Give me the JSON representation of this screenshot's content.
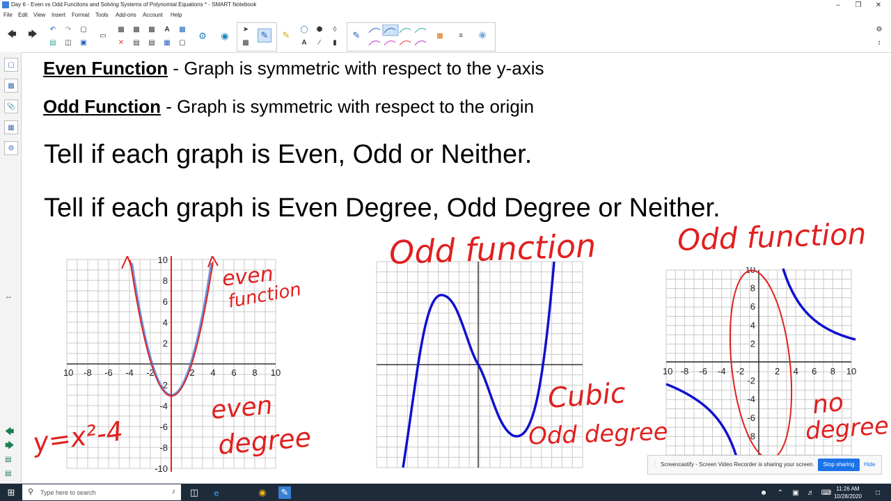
{
  "window": {
    "title": "Day 6 - Even vs Odd Funcitons and Solving Systems of Polynomial Equations * - SMART Notebook",
    "controls": {
      "minimize": "–",
      "restore": "❐",
      "close": "✕"
    }
  },
  "menu": [
    "File",
    "Edit",
    "View",
    "Insert",
    "Format",
    "Tools",
    "Add-ons",
    "Account",
    "Help"
  ],
  "canvas": {
    "even_term": "Even Function",
    "even_desc": " - Graph is symmetric with respect to the y-axis",
    "odd_term": "Odd Function",
    "odd_desc": " - Graph is symmetric with respect to the origin",
    "question1": "Tell if each graph is Even, Odd or Neither.",
    "question2": "Tell if each graph  is Even Degree, Odd Degree or Neither."
  },
  "graph1": {
    "y_ticks": [
      "10",
      "8",
      "6",
      "4",
      "2",
      "-2",
      "-4",
      "-6",
      "-8",
      "-10"
    ],
    "x_ticks": [
      "-10",
      "-8",
      "-6",
      "-4",
      "-2",
      "2",
      "4",
      "6",
      "8",
      "10"
    ]
  },
  "graph3": {
    "x_ticks": [
      "-10",
      "-8",
      "-6",
      "-4",
      "-2",
      "2",
      "4",
      "6",
      "8",
      "10"
    ],
    "y_ticks": [
      "10",
      "8",
      "6",
      "4",
      "2",
      "-2",
      "-4",
      "-6",
      "-8"
    ]
  },
  "handwriting": {
    "g1_top": [
      "even",
      "function"
    ],
    "g1_bottom": [
      "even",
      "degree"
    ],
    "g1_eq": "y=x²-4",
    "g2_top": "Odd function",
    "g2_bottom": [
      "Cubic",
      "Odd degree"
    ],
    "g3_top": "Odd function",
    "g3_bottom": [
      "no",
      "degree"
    ]
  },
  "notification": {
    "message": "Screencastify - Screen Video Recorder is sharing your screen.",
    "stop": "Stop sharing",
    "hide": "Hide"
  },
  "taskbar": {
    "search_placeholder": "Type here to search",
    "time": "11:26 AM",
    "date": "10/28/2020"
  },
  "colors": {
    "ink_red": "#e02020",
    "curve_blue": "#1010d0",
    "accent": "#1a73e8"
  }
}
